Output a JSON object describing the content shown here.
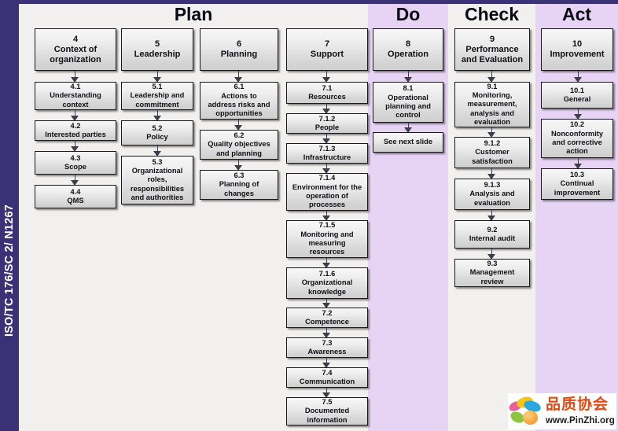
{
  "sidebar": {
    "reference": "ISO/TC 176/SC 2/ N1267"
  },
  "phases": [
    {
      "key": "plan",
      "label": "Plan"
    },
    {
      "key": "do",
      "label": "Do"
    },
    {
      "key": "check",
      "label": "Check"
    },
    {
      "key": "act",
      "label": "Act"
    }
  ],
  "columns": {
    "context": {
      "header": "4\nContext of\norganization",
      "items": [
        "4.1\nUnderstanding\ncontext",
        "4.2\nInterested parties",
        "4.3\nScope",
        "4.4\nQMS"
      ]
    },
    "leadership": {
      "header": "5\nLeadership",
      "items": [
        "5.1\nLeadership and\ncommitment",
        "5.2\nPolicy",
        "5.3\nOrganizational\nroles,\nresponsibilities\nand authorities"
      ]
    },
    "planning": {
      "header": "6\nPlanning",
      "items": [
        "6.1\nActions to\naddress risks and\nopportunities",
        "6.2\nQuality objectives\nand planning",
        "6.3\nPlanning of\nchanges"
      ]
    },
    "support": {
      "header": "7\nSupport",
      "items": [
        "7.1\nResources",
        "7.1.2\nPeople",
        "7.1.3\nInfrastructure",
        "7.1.4\nEnvironment for the\noperation of\nprocesses",
        "7.1.5\nMonitoring and\nmeasuring\nresources",
        "7.1.6\nOrganizational\nknowledge",
        "7.2\nCompetence",
        "7.3\nAwareness",
        "7.4\nCommunication",
        "7.5\nDocumented\ninformation"
      ]
    },
    "operation": {
      "header": "8\nOperation",
      "items": [
        "8.1\nOperational\nplanning and\ncontrol",
        "See next  slide"
      ]
    },
    "performance": {
      "header": "9\nPerformance\nand Evaluation",
      "items": [
        "9.1\nMonitoring,\nmeasurement,\nanalysis and\nevaluation",
        "9.1.2\nCustomer\nsatisfaction",
        "9.1.3\nAnalysis and\nevaluation",
        "9.2\nInternal audit",
        "9.3\nManagement\nreview"
      ]
    },
    "improvement": {
      "header": "10\nImprovement",
      "items": [
        "10.1\nGeneral",
        "10.2\nNonconformity\nand corrective\naction",
        "10.3\nContinual\nimprovement"
      ]
    }
  },
  "watermark": {
    "name": "品质协会",
    "url": "www.PinZhi.org"
  },
  "colors": {
    "spine": "#3b3176",
    "lane_light": "#f1f0ee",
    "lane_lavender": "#e7d4f5",
    "box_border": "#17171c",
    "arrow": "#3d3d4a",
    "logo_text": "#e8470f"
  }
}
